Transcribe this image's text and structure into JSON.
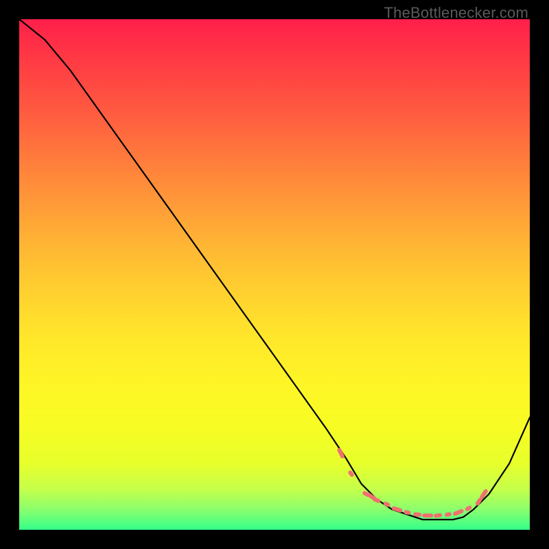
{
  "watermark": "TheBottlenecker.com",
  "chart_data": {
    "type": "line",
    "title": "",
    "xlabel": "",
    "ylabel": "",
    "xlim": [
      0,
      100
    ],
    "ylim": [
      0,
      100
    ],
    "x": [
      0,
      5,
      10,
      15,
      20,
      25,
      30,
      35,
      40,
      45,
      50,
      55,
      60,
      64,
      67,
      70,
      73,
      76,
      79,
      82,
      85,
      87,
      89,
      92,
      96,
      100
    ],
    "y": [
      100,
      96,
      90,
      83,
      76,
      69,
      62,
      55,
      48,
      41,
      34,
      27,
      20,
      14,
      9,
      6,
      4,
      3,
      2,
      2,
      2,
      2.5,
      4,
      7,
      13,
      22
    ],
    "dashed_segments": {
      "x": [
        63,
        65,
        68,
        69,
        70,
        72,
        74,
        76,
        78,
        80,
        82,
        84,
        86,
        88,
        90,
        91
      ],
      "y": [
        15,
        11,
        7,
        6.5,
        5.8,
        5,
        4,
        3.4,
        3,
        2.8,
        2.8,
        3,
        3.4,
        4.2,
        5.5,
        7
      ]
    },
    "series_color": "#000000",
    "dashed_color": "#f07070",
    "background": "rainbow_vertical_gradient"
  }
}
